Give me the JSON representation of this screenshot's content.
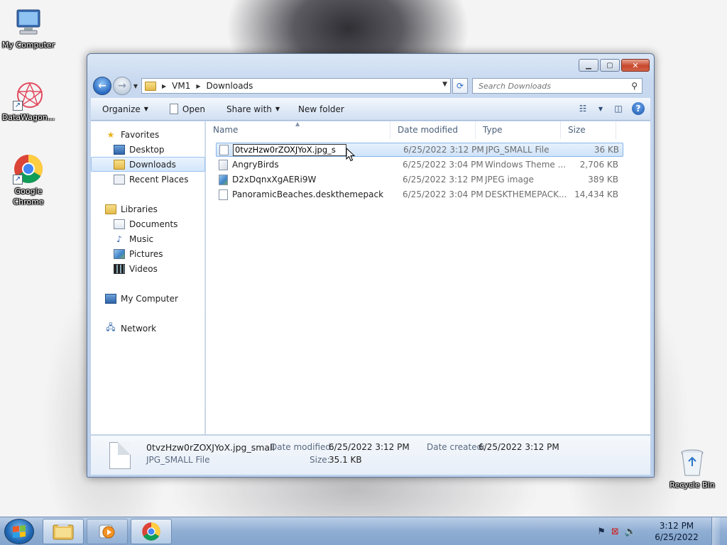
{
  "desktop": {
    "icons": [
      {
        "label": "My Computer"
      },
      {
        "label": "DataWagon..."
      },
      {
        "label": "Google Chrome"
      },
      {
        "label": "Recycle Bin"
      }
    ]
  },
  "window": {
    "address": {
      "crumbs": [
        "VM1",
        "Downloads"
      ]
    },
    "search": {
      "placeholder": "Search Downloads"
    },
    "toolbar": {
      "organize": "Organize",
      "open": "Open",
      "share_with": "Share with",
      "new_folder": "New folder"
    },
    "nav": {
      "favorites": "Favorites",
      "desktop": "Desktop",
      "downloads": "Downloads",
      "recent_places": "Recent Places",
      "libraries": "Libraries",
      "documents": "Documents",
      "music": "Music",
      "pictures": "Pictures",
      "videos": "Videos",
      "my_computer": "My Computer",
      "network": "Network"
    },
    "columns": {
      "name": "Name",
      "date_modified": "Date modified",
      "type": "Type",
      "size": "Size"
    },
    "files": [
      {
        "name": "0tvzHzw0rZOXJYoX.jpg_small",
        "rename_value": "0tvzHzw0rZOXJYoX.jpg_s",
        "date": "6/25/2022 3:12 PM",
        "type": "JPG_SMALL File",
        "size": "36 KB"
      },
      {
        "name": "AngryBirds",
        "date": "6/25/2022 3:04 PM",
        "type": "Windows Theme ...",
        "size": "2,706 KB"
      },
      {
        "name": "D2xDqnxXgAERi9W",
        "date": "6/25/2022 3:12 PM",
        "type": "JPEG image",
        "size": "389 KB"
      },
      {
        "name": "PanoramicBeaches.deskthemepack",
        "date": "6/25/2022 3:04 PM",
        "type": "DESKTHEMEPACK...",
        "size": "14,434 KB"
      }
    ],
    "details": {
      "filename": "0tvzHzw0rZOXJYoX.jpg_small",
      "filetype": "JPG_SMALL File",
      "date_modified_label": "Date modified:",
      "date_modified": "6/25/2022 3:12 PM",
      "date_created_label": "Date created:",
      "date_created": "6/25/2022 3:12 PM",
      "size_label": "Size:",
      "size": "35.1 KB"
    }
  },
  "taskbar": {
    "time": "3:12 PM",
    "date": "6/25/2022"
  },
  "colors": {
    "selection_border": "#86b5e8",
    "close_button": "#c7482d",
    "taskbar": "#90aed3"
  }
}
